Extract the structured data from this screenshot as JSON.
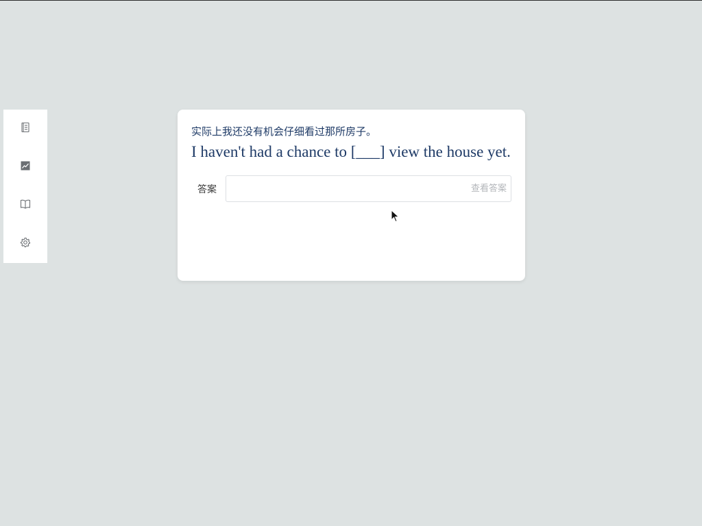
{
  "sidebar": {
    "items": [
      {
        "icon": "notebook-icon"
      },
      {
        "icon": "chart-icon"
      },
      {
        "icon": "book-icon"
      },
      {
        "icon": "gear-icon"
      }
    ]
  },
  "card": {
    "chinese": "实际上我还没有机会仔细看过那所房子。",
    "english": "I haven't had a chance to [___] view the house yet.",
    "answer_label": "答案",
    "answer_value": "",
    "answer_placeholder": "",
    "show_answer": "查看答案"
  },
  "colors": {
    "background": "#dde2e2",
    "text_primary": "#1e3a66",
    "hint": "#b3b6ba"
  }
}
